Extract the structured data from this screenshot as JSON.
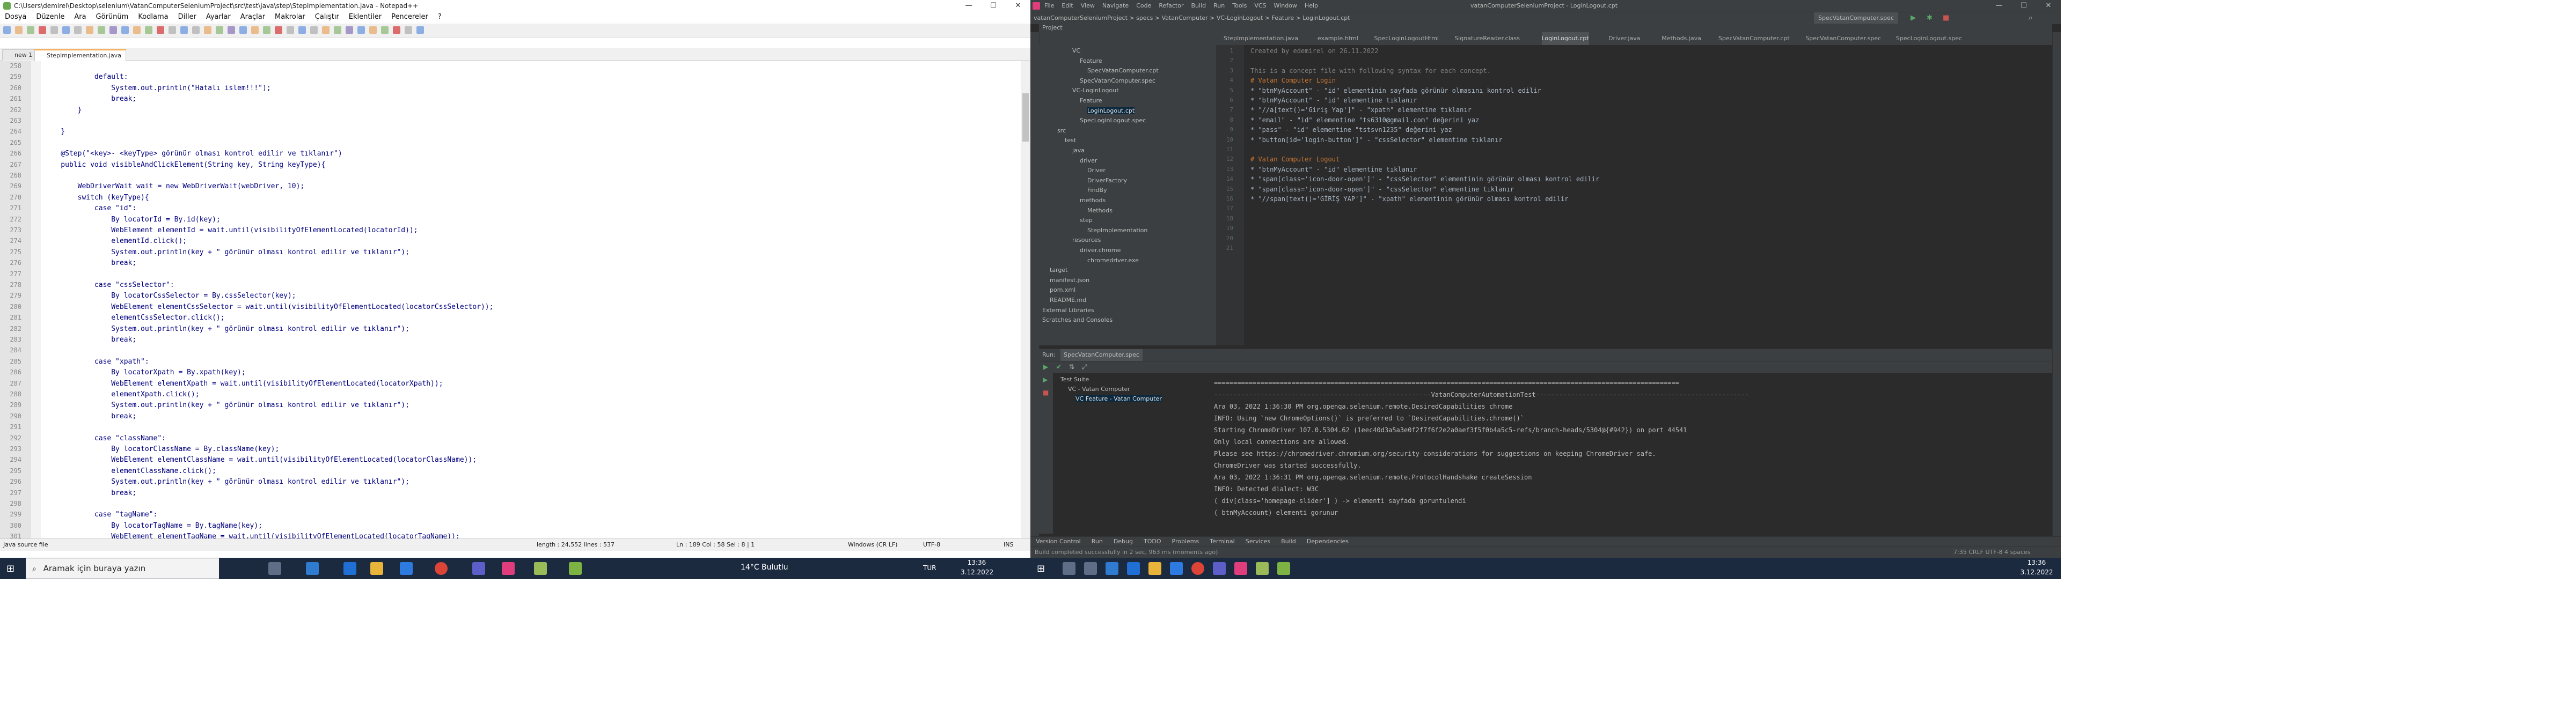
{
  "notepad": {
    "title": "C:\\Users\\demirel\\Desktop\\selenium\\VatanComputerSeleniumProject\\src\\test\\java\\step\\StepImplementation.java - Notepad++",
    "menu": [
      "Dosya",
      "Düzenle",
      "Ara",
      "Görünüm",
      "Kodlama",
      "Diller",
      "Ayarlar",
      "Araçlar",
      "Makrolar",
      "Çalıştır",
      "Eklentiler",
      "Pencereler",
      "?"
    ],
    "tabs": [
      "new 1",
      "StepImplementation.java"
    ],
    "active_tab": "StepImplementation.java",
    "lines": [
      {
        "n": "258",
        "t": ""
      },
      {
        "n": "259",
        "t": "            default:"
      },
      {
        "n": "260",
        "t": "                System.out.println(\"Hatalı islem!!!\");"
      },
      {
        "n": "261",
        "t": "                break;"
      },
      {
        "n": "262",
        "t": "        }"
      },
      {
        "n": "263",
        "t": ""
      },
      {
        "n": "264",
        "t": "    }"
      },
      {
        "n": "265",
        "t": ""
      },
      {
        "n": "266",
        "t": "    @Step(\"<key>- <keyType> görünür olması kontrol edilir ve tıklanır\")"
      },
      {
        "n": "267",
        "t": "    public void visibleAndClickElement(String key, String keyType){"
      },
      {
        "n": "268",
        "t": ""
      },
      {
        "n": "269",
        "t": "        WebDriverWait wait = new WebDriverWait(webDriver, 10);"
      },
      {
        "n": "270",
        "t": "        switch (keyType){"
      },
      {
        "n": "271",
        "t": "            case \"id\":"
      },
      {
        "n": "272",
        "t": "                By locatorId = By.id(key);"
      },
      {
        "n": "273",
        "t": "                WebElement elementId = wait.until(visibilityOfElementLocated(locatorId));"
      },
      {
        "n": "274",
        "t": "                elementId.click();"
      },
      {
        "n": "275",
        "t": "                System.out.println(key + \" görünür olması kontrol edilir ve tıklanır\");"
      },
      {
        "n": "276",
        "t": "                break;"
      },
      {
        "n": "277",
        "t": ""
      },
      {
        "n": "278",
        "t": "            case \"cssSelector\":"
      },
      {
        "n": "279",
        "t": "                By locatorCssSelector = By.cssSelector(key);"
      },
      {
        "n": "280",
        "t": "                WebElement elementCssSelector = wait.until(visibilityOfElementLocated(locatorCssSelector));"
      },
      {
        "n": "281",
        "t": "                elementCssSelector.click();"
      },
      {
        "n": "282",
        "t": "                System.out.println(key + \" görünür olması kontrol edilir ve tıklanır\");"
      },
      {
        "n": "283",
        "t": "                break;"
      },
      {
        "n": "284",
        "t": ""
      },
      {
        "n": "285",
        "t": "            case \"xpath\":"
      },
      {
        "n": "286",
        "t": "                By locatorXpath = By.xpath(key);"
      },
      {
        "n": "287",
        "t": "                WebElement elementXpath = wait.until(visibilityOfElementLocated(locatorXpath));"
      },
      {
        "n": "288",
        "t": "                elementXpath.click();"
      },
      {
        "n": "289",
        "t": "                System.out.println(key + \" görünür olması kontrol edilir ve tıklanır\");"
      },
      {
        "n": "290",
        "t": "                break;"
      },
      {
        "n": "291",
        "t": ""
      },
      {
        "n": "292",
        "t": "            case \"className\":"
      },
      {
        "n": "293",
        "t": "                By locatorClassName = By.className(key);"
      },
      {
        "n": "294",
        "t": "                WebElement elementClassName = wait.until(visibilityOfElementLocated(locatorClassName));"
      },
      {
        "n": "295",
        "t": "                elementClassName.click();"
      },
      {
        "n": "296",
        "t": "                System.out.println(key + \" görünür olması kontrol edilir ve tıklanır\");"
      },
      {
        "n": "297",
        "t": "                break;"
      },
      {
        "n": "298",
        "t": ""
      },
      {
        "n": "299",
        "t": "            case \"tagName\":"
      },
      {
        "n": "300",
        "t": "                By locatorTagName = By.tagName(key);"
      },
      {
        "n": "301",
        "t": "                WebElement elementTagName = wait.until(visibilityOfElementLocated(locatorTagName));"
      }
    ],
    "status": {
      "type": "Java source file",
      "length": "length : 24,552   lines : 537",
      "pos": "Ln : 189   Col : 58   Sel : 8 | 1",
      "eol": "Windows (CR LF)",
      "enc": "UTF-8",
      "ins": "INS"
    }
  },
  "taskbar": {
    "search": "Aramak için buraya yazın",
    "weather": "14°C  Bulutlu",
    "lang": "TUR",
    "time": "13:36",
    "date": "3.12.2022"
  },
  "intellij": {
    "title": "vatanComputerSeleniumProject - LoginLogout.cpt",
    "menu": [
      "File",
      "Edit",
      "View",
      "Navigate",
      "Code",
      "Refactor",
      "Build",
      "Run",
      "Tools",
      "VCS",
      "Window",
      "Help"
    ],
    "breadcrumb": "vatanComputerSeleniumProject  >  specs  >  VatanComputer  >  VC-LoginLogout  >  Feature  >  LoginLogout.cpt",
    "run_config": "SpecVatanComputer.spec",
    "tabs": [
      "StepImplementation.java",
      "example.html",
      "SpecLoginLogoutHtml",
      "SignatureReader.class",
      "LoginLogout.cpt",
      "Driver.java",
      "Methods.java",
      "SpecVatanComputer.cpt",
      "SpecVatanComputer.spec",
      "SpecLoginLogout.spec"
    ],
    "active_tab": "LoginLogout.cpt",
    "project_label": "Project",
    "tree": [
      {
        "d": 4,
        "t": "VC"
      },
      {
        "d": 5,
        "t": "Feature"
      },
      {
        "d": 6,
        "t": "SpecVatanComputer.cpt"
      },
      {
        "d": 5,
        "t": "SpecVatanComputer.spec"
      },
      {
        "d": 4,
        "t": "VC-LoginLogout"
      },
      {
        "d": 5,
        "t": "Feature"
      },
      {
        "d": 6,
        "t": "LoginLogout.cpt",
        "sel": true
      },
      {
        "d": 5,
        "t": "SpecLoginLogout.spec"
      },
      {
        "d": 2,
        "t": "src"
      },
      {
        "d": 3,
        "t": "test"
      },
      {
        "d": 4,
        "t": "java"
      },
      {
        "d": 5,
        "t": "driver"
      },
      {
        "d": 6,
        "t": "Driver"
      },
      {
        "d": 6,
        "t": "DriverFactory"
      },
      {
        "d": 6,
        "t": "FindBy"
      },
      {
        "d": 5,
        "t": "methods"
      },
      {
        "d": 6,
        "t": "Methods"
      },
      {
        "d": 5,
        "t": "step"
      },
      {
        "d": 6,
        "t": "StepImplementation"
      },
      {
        "d": 4,
        "t": "resources"
      },
      {
        "d": 5,
        "t": "driver.chrome"
      },
      {
        "d": 6,
        "t": "chromedriver.exe"
      },
      {
        "d": 1,
        "t": "target"
      },
      {
        "d": 1,
        "t": "manifest.json"
      },
      {
        "d": 1,
        "t": "pom.xml"
      },
      {
        "d": 1,
        "t": "README.md"
      },
      {
        "d": 0,
        "t": "External Libraries"
      },
      {
        "d": 0,
        "t": "Scratches and Consoles"
      }
    ],
    "editor_lines": [
      {
        "n": "1",
        "t": "Created by edemirel on 26.11.2022",
        "cls": "c"
      },
      {
        "n": "2",
        "t": ""
      },
      {
        "n": "3",
        "t": "This is a concept file with following syntax for each concept.",
        "cls": "c"
      },
      {
        "n": "4",
        "t": "# Vatan Computer Login",
        "cls": "kw"
      },
      {
        "n": "5",
        "t": "* \"btnMyAccount\" - \"id\" elementinin sayfada görünür olmasını kontrol edilir"
      },
      {
        "n": "6",
        "t": "* \"btnMyAccount\" - \"id\" elementine tıklanır"
      },
      {
        "n": "7",
        "t": "* \"//a[text()='Giriş Yap']\" - \"xpath\" elementine tıklanır"
      },
      {
        "n": "8",
        "t": "* \"email\" - \"id\" elementine \"ts6310@gmail.com\" değerini yaz"
      },
      {
        "n": "9",
        "t": "* \"pass\" - \"id\" elementine \"tstsvn1235\" değerini yaz"
      },
      {
        "n": "10",
        "t": "* \"button[id='login-button']\" - \"cssSelector\" elementine tıklanır"
      },
      {
        "n": "11",
        "t": ""
      },
      {
        "n": "12",
        "t": "# Vatan Computer Logout",
        "cls": "kw"
      },
      {
        "n": "13",
        "t": "* \"btnMyAccount\" - \"id\" elementine tıklanır"
      },
      {
        "n": "14",
        "t": "* \"span[class='icon-door-open']\" - \"cssSelector\" elementinin görünür olması kontrol edilir"
      },
      {
        "n": "15",
        "t": "* \"span[class='icon-door-open']\" - \"cssSelector\" elementine tıklanır"
      },
      {
        "n": "16",
        "t": "* \"//span[text()='GİRİŞ YAP']\" - \"xpath\" elementinin görünür olması kontrol edilir"
      },
      {
        "n": "17",
        "t": ""
      },
      {
        "n": "18",
        "t": ""
      },
      {
        "n": "19",
        "t": ""
      },
      {
        "n": "20",
        "t": ""
      },
      {
        "n": "21",
        "t": ""
      }
    ],
    "run_label": "Run:",
    "run_tab": "SpecVatanComputer.spec",
    "run_tree": [
      "Test Suite",
      "VC - Vatan Computer",
      "VC Feature - Vatan Computer"
    ],
    "console": [
      "========================================================================================================================",
      "--------------------------------------------------------VatanComputerAutomationTest-------------------------------------------------------",
      "Ara 03, 2022 1:36:30 PM org.openqa.selenium.remote.DesiredCapabilities chrome",
      "INFO: Using `new ChromeOptions()` is preferred to `DesiredCapabilities.chrome()`",
      "Starting ChromeDriver 107.0.5304.62 (1eec40d3a5a3e0f2f7f6f2e2a0aef3f5f0b4a5c5-refs/branch-heads/5304@{#942}) on port 44541",
      "Only local connections are allowed.",
      "Please see https://chromedriver.chromium.org/security-considerations for suggestions on keeping ChromeDriver safe.",
      "ChromeDriver was started successfully.",
      "Ara 03, 2022 1:36:31 PM org.openqa.selenium.remote.ProtocolHandshake createSession",
      "INFO: Detected dialect: W3C",
      "( div[class='homepage-slider'] ) -> elementi sayfada goruntulendi",
      "( btnMyAccount) elementi gorunur"
    ],
    "bottom_tabs": [
      "Version Control",
      "Run",
      "Debug",
      "TODO",
      "Problems",
      "Terminal",
      "Services",
      "Build",
      "Dependencies"
    ],
    "status_left": "Build completed successfully in 2 sec, 963 ms (moments ago)",
    "status_right": "7:35   CRLF   UTF-8   4 spaces"
  },
  "taskbar2": {
    "time": "13:36",
    "date": "3.12.2022"
  }
}
